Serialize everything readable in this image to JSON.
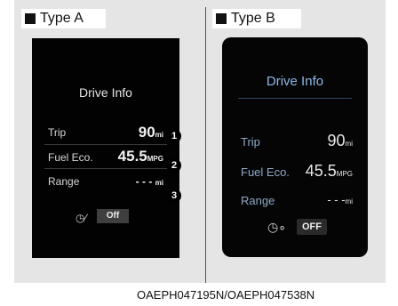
{
  "type_a": {
    "label": "Type A",
    "title": "Drive Info",
    "trip": {
      "label": "Trip",
      "value": "90",
      "unit": "mi"
    },
    "fuel": {
      "label": "Fuel Eco.",
      "value": "45.5",
      "unit": "MPG"
    },
    "range": {
      "label": "Range",
      "value": "- - -",
      "unit": "mi"
    },
    "clock_icon": "clock-fuel-icon",
    "off_label": "Off",
    "callouts": [
      "1",
      "2",
      "3"
    ]
  },
  "type_b": {
    "label": "Type B",
    "title": "Drive Info",
    "trip": {
      "label": "Trip",
      "value": "90",
      "unit": "mi"
    },
    "fuel": {
      "label": "Fuel Eco.",
      "value": "45.5",
      "unit": "MPG"
    },
    "range": {
      "label": "Range",
      "value": "- - -",
      "unit": "mi"
    },
    "clock_icon": "clock-fuel-icon",
    "off_label": "OFF"
  },
  "image_code": "OAEPH047195N/OAEPH047538N",
  "colors": {
    "screen_bg": "#020202",
    "type_b_title": "#8fb8ec",
    "frame_bg": "#e5e5e5"
  }
}
